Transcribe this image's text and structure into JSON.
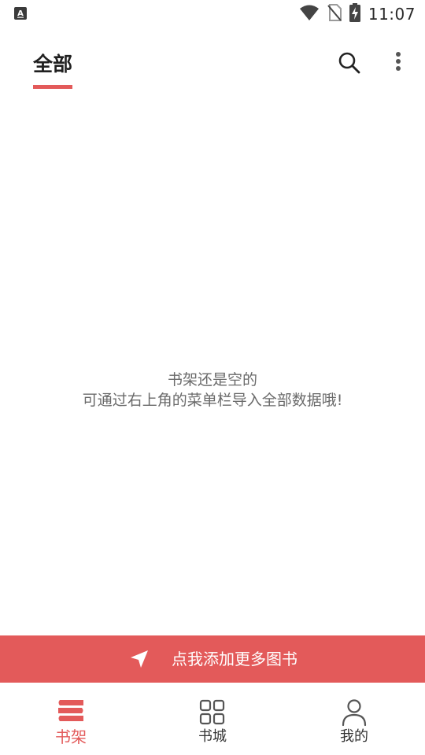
{
  "status_bar": {
    "time": "11:07",
    "icons": [
      "keyboard-a-icon",
      "wifi-icon",
      "no-sim-icon",
      "battery-charging-icon"
    ]
  },
  "header": {
    "tab_all": "全部",
    "search_icon": "search-icon",
    "more_icon": "more-vert-icon"
  },
  "empty_state": {
    "line1": "书架还是空的",
    "line2": "可通过右上角的菜单栏导入全部数据哦!"
  },
  "banner": {
    "icon": "send-icon",
    "label": "点我添加更多图书"
  },
  "bottom_nav": {
    "items": [
      {
        "label": "书架",
        "icon": "bookshelf-icon",
        "active": true
      },
      {
        "label": "书城",
        "icon": "grid-icon",
        "active": false
      },
      {
        "label": "我的",
        "icon": "person-icon",
        "active": false
      }
    ]
  },
  "colors": {
    "accent": "#e35a5a",
    "text_primary": "#202020",
    "text_secondary": "#6a6a6a"
  }
}
